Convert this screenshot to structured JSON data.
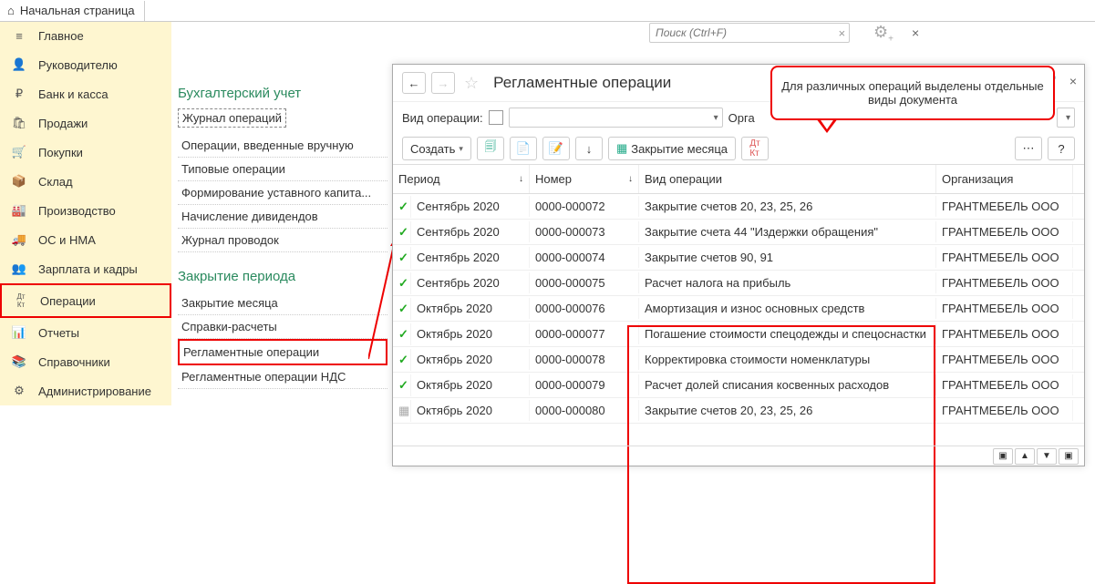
{
  "topBar": {
    "homeTab": "Начальная страница"
  },
  "search": {
    "placeholder": "Поиск (Ctrl+F)"
  },
  "sidebar": {
    "items": [
      {
        "icon": "≡",
        "label": "Главное"
      },
      {
        "icon": "👤",
        "label": "Руководителю"
      },
      {
        "icon": "₽",
        "label": "Банк и касса"
      },
      {
        "icon": "🛍",
        "label": "Продажи"
      },
      {
        "icon": "🛒",
        "label": "Покупки"
      },
      {
        "icon": "📦",
        "label": "Склад"
      },
      {
        "icon": "🏭",
        "label": "Производство"
      },
      {
        "icon": "🚚",
        "label": "ОС и НМА"
      },
      {
        "icon": "👥",
        "label": "Зарплата и кадры"
      },
      {
        "icon": "Дт Кт",
        "label": "Операции",
        "active": true
      },
      {
        "icon": "📊",
        "label": "Отчеты"
      },
      {
        "icon": "📚",
        "label": "Справочники"
      },
      {
        "icon": "⚙",
        "label": "Администрирование"
      }
    ]
  },
  "subpanel": {
    "group1": {
      "title": "Бухгалтерский учет",
      "items": [
        "Журнал операций",
        "Операции, введенные вручную",
        "Типовые операции",
        "Формирование уставного капита...",
        "Начисление дивидендов",
        "Журнал проводок"
      ]
    },
    "group2": {
      "title": "Закрытие периода",
      "items": [
        "Закрытие месяца",
        "Справки-расчеты",
        "Регламентные операции",
        "Регламентные операции НДС"
      ]
    }
  },
  "window": {
    "title": "Регламентные операции",
    "filterLabel": "Вид операции:",
    "orgLabel": "Орга",
    "createBtn": "Создать",
    "monthCloseBtn": "Закрытие месяца"
  },
  "table": {
    "headers": {
      "period": "Период",
      "number": "Номер",
      "op": "Вид операции",
      "org": "Организация"
    },
    "rows": [
      {
        "check": true,
        "period": "Сентябрь 2020",
        "num": "0000-000072",
        "op": "Закрытие счетов 20, 23, 25, 26",
        "org": "ГРАНТМЕБЕЛЬ ООО"
      },
      {
        "check": true,
        "period": "Сентябрь 2020",
        "num": "0000-000073",
        "op": "Закрытие счета 44 \"Издержки обращения\"",
        "org": "ГРАНТМЕБЕЛЬ ООО"
      },
      {
        "check": true,
        "period": "Сентябрь 2020",
        "num": "0000-000074",
        "op": "Закрытие счетов 90, 91",
        "org": "ГРАНТМЕБЕЛЬ ООО"
      },
      {
        "check": true,
        "period": "Сентябрь 2020",
        "num": "0000-000075",
        "op": "Расчет налога на прибыль",
        "org": "ГРАНТМЕБЕЛЬ ООО"
      },
      {
        "check": true,
        "period": "Октябрь 2020",
        "num": "0000-000076",
        "op": "Амортизация и износ основных средств",
        "org": "ГРАНТМЕБЕЛЬ ООО"
      },
      {
        "check": true,
        "period": "Октябрь 2020",
        "num": "0000-000077",
        "op": "Погашение стоимости спецодежды и спецоснастки",
        "org": "ГРАНТМЕБЕЛЬ ООО"
      },
      {
        "check": true,
        "period": "Октябрь 2020",
        "num": "0000-000078",
        "op": "Корректировка стоимости номенклатуры",
        "org": "ГРАНТМЕБЕЛЬ ООО"
      },
      {
        "check": true,
        "period": "Октябрь 2020",
        "num": "0000-000079",
        "op": "Расчет долей списания косвенных расходов",
        "org": "ГРАНТМЕБЕЛЬ ООО"
      },
      {
        "check": false,
        "period": "Октябрь 2020",
        "num": "0000-000080",
        "op": "Закрытие счетов 20, 23, 25, 26",
        "org": "ГРАНТМЕБЕЛЬ ООО"
      }
    ]
  },
  "callout": "Для различных операций выделены отдельные виды документа"
}
